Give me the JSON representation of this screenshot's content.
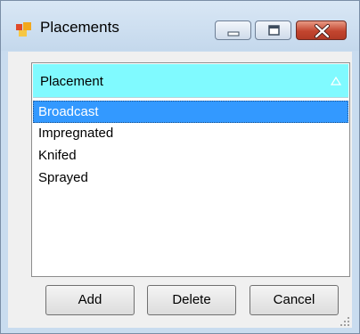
{
  "window": {
    "title": "Placements",
    "icon": "form-icon",
    "controls": [
      "minimize-icon",
      "maximize-icon",
      "close-icon"
    ]
  },
  "list": {
    "column_header": "Placement",
    "sort_indicator": "sort-ascending-icon",
    "header_color": "#80faff",
    "selection_color": "#3399ff",
    "items": [
      "Broadcast",
      "Impregnated",
      "Knifed",
      "Sprayed"
    ],
    "selected_item": "Broadcast"
  },
  "buttons": {
    "add": "Add",
    "delete": "Delete",
    "cancel": "Cancel"
  }
}
